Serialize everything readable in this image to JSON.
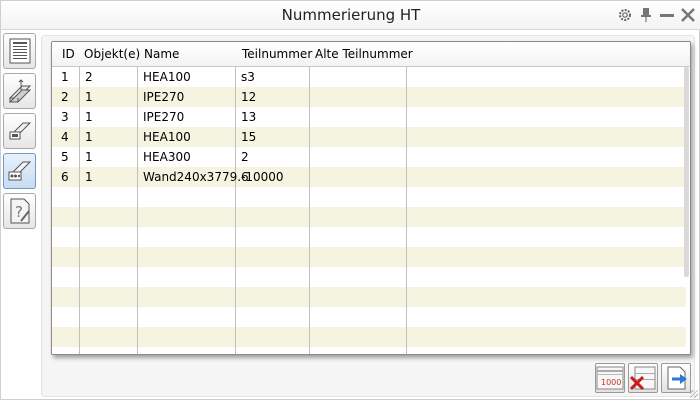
{
  "window": {
    "title": "Nummerierung HT"
  },
  "titlebar_icons": [
    "gear-icon",
    "pin-icon",
    "minimize-icon",
    "close-icon"
  ],
  "left_toolbar": [
    {
      "name": "list-view-icon",
      "active": false
    },
    {
      "name": "beam-profile-icon",
      "active": false
    },
    {
      "name": "profile-detail-icon",
      "active": false
    },
    {
      "name": "numbering-icon",
      "active": true
    },
    {
      "name": "help-document-icon",
      "active": false
    }
  ],
  "table": {
    "headers": [
      "ID",
      "Objekt(e)",
      "Name",
      "Teilnummer",
      "Alte Teilnummer"
    ],
    "rows": [
      [
        "1",
        "2",
        "HEA100",
        "s3",
        ""
      ],
      [
        "2",
        "1",
        "IPE270",
        "12",
        ""
      ],
      [
        "3",
        "1",
        "IPE270",
        "13",
        ""
      ],
      [
        "4",
        "1",
        "HEA100",
        "15",
        ""
      ],
      [
        "5",
        "1",
        "HEA300",
        "2",
        ""
      ],
      [
        "6",
        "1",
        "Wand240x3779.6",
        "-10000",
        ""
      ]
    ]
  },
  "bottom_buttons": [
    {
      "name": "start-number-button",
      "label": "1000"
    },
    {
      "name": "clear-numbers-button",
      "label": ""
    },
    {
      "name": "export-button",
      "label": ""
    }
  ],
  "colors": {
    "row_alt": "#f4f4e0",
    "active_tool": "#c8dcf1",
    "delete_red": "#cc1b1b",
    "arrow_blue": "#2a7ad5"
  }
}
